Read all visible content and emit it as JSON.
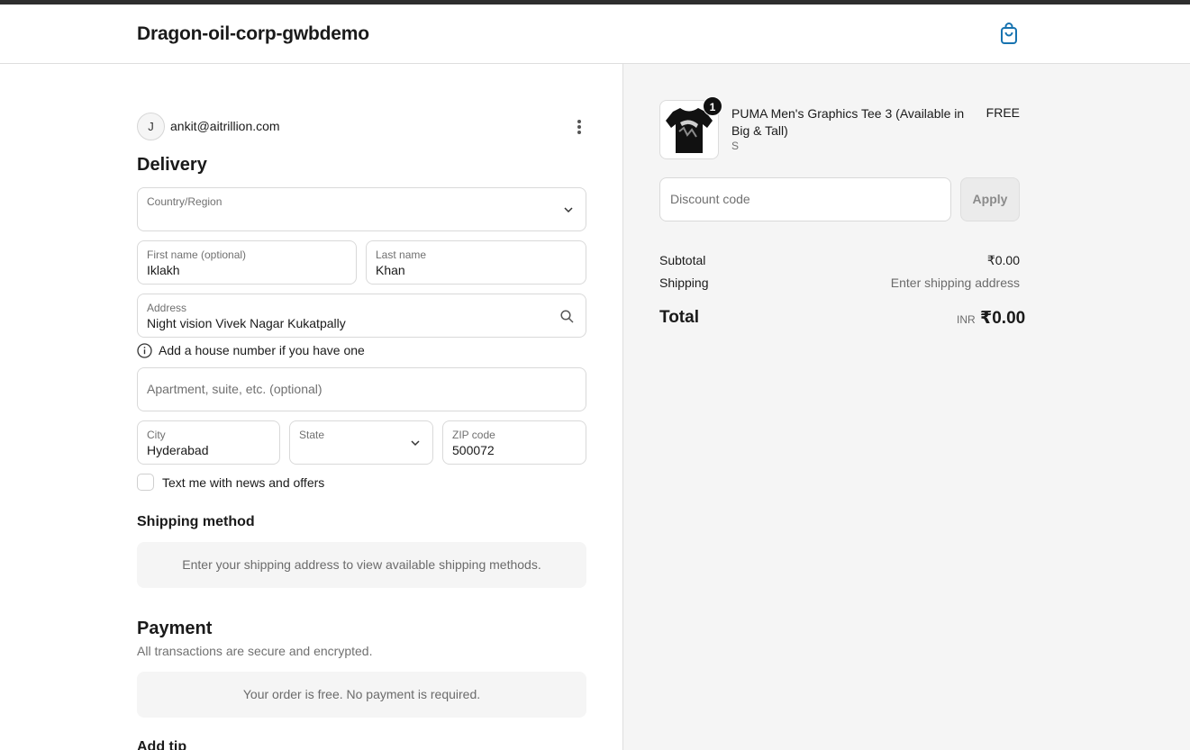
{
  "header": {
    "store_name": "Dragon-oil-corp-gwbdemo",
    "cart_icon": "shopping-bag-icon",
    "accent_color": "#1773b0"
  },
  "account": {
    "avatar_initial": "J",
    "email": "ankit@aitrillion.com",
    "menu_icon": "more-vertical-icon"
  },
  "delivery": {
    "heading": "Delivery",
    "country": {
      "label": "Country/Region",
      "value": ""
    },
    "first_name": {
      "label": "First name (optional)",
      "value": "Iklakh"
    },
    "last_name": {
      "label": "Last name",
      "value": "Khan"
    },
    "address": {
      "label": "Address",
      "value": "Night vision Vivek Nagar Kukatpally"
    },
    "address_hint": "Add a house number if you have one",
    "apartment": {
      "placeholder": "Apartment, suite, etc. (optional)"
    },
    "city": {
      "label": "City",
      "value": "Hyderabad"
    },
    "state": {
      "label": "State",
      "value": ""
    },
    "zip": {
      "label": "ZIP code",
      "value": "500072"
    },
    "sms_opt_in": {
      "label": "Text me with news and offers",
      "checked": false
    }
  },
  "shipping": {
    "heading": "Shipping method",
    "notice": "Enter your shipping address to view available shipping methods."
  },
  "payment": {
    "heading": "Payment",
    "subtitle": "All transactions are secure and encrypted.",
    "notice": "Your order is free. No payment is required."
  },
  "tip": {
    "heading": "Add tip"
  },
  "summary": {
    "product": {
      "title": "PUMA Men's Graphics Tee 3 (Available in Big & Tall)",
      "variant": "S",
      "quantity": "1",
      "price": "FREE"
    },
    "discount": {
      "placeholder": "Discount code",
      "apply_label": "Apply"
    },
    "subtotal_label": "Subtotal",
    "subtotal_value": "₹0.00",
    "shipping_label": "Shipping",
    "shipping_value": "Enter shipping address",
    "total_label": "Total",
    "total_currency": "INR",
    "total_value": "₹0.00"
  }
}
